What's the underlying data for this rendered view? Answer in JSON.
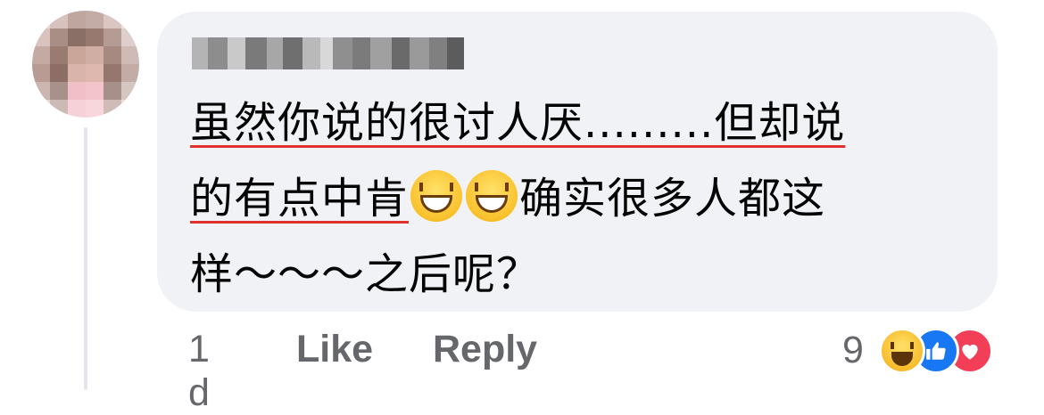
{
  "comment": {
    "author_name_redacted": true,
    "text_line1": "虽然你说的很讨人厌.........但却说",
    "text_line2_part1": "的有点中肯",
    "text_line2_part2": "确实很多人都这",
    "text_line3": "样～～～之后呢？",
    "emoji_icons": [
      "grinning-squinting-face-icon",
      "grinning-squinting-face-icon"
    ]
  },
  "footer": {
    "time": "1 d",
    "like_label": "Like",
    "reply_label": "Reply",
    "reaction_count": "9",
    "reaction_icons": [
      "haha-reaction-icon",
      "like-reaction-icon",
      "love-reaction-icon"
    ]
  },
  "colors": {
    "bubble_bg": "#f0f2f5",
    "secondary_text": "#65676b",
    "spellcheck_underline": "#e0312f",
    "like_blue": "#1877f2",
    "love_red": "#f33e58",
    "haha_yellow": "#f7b928"
  }
}
